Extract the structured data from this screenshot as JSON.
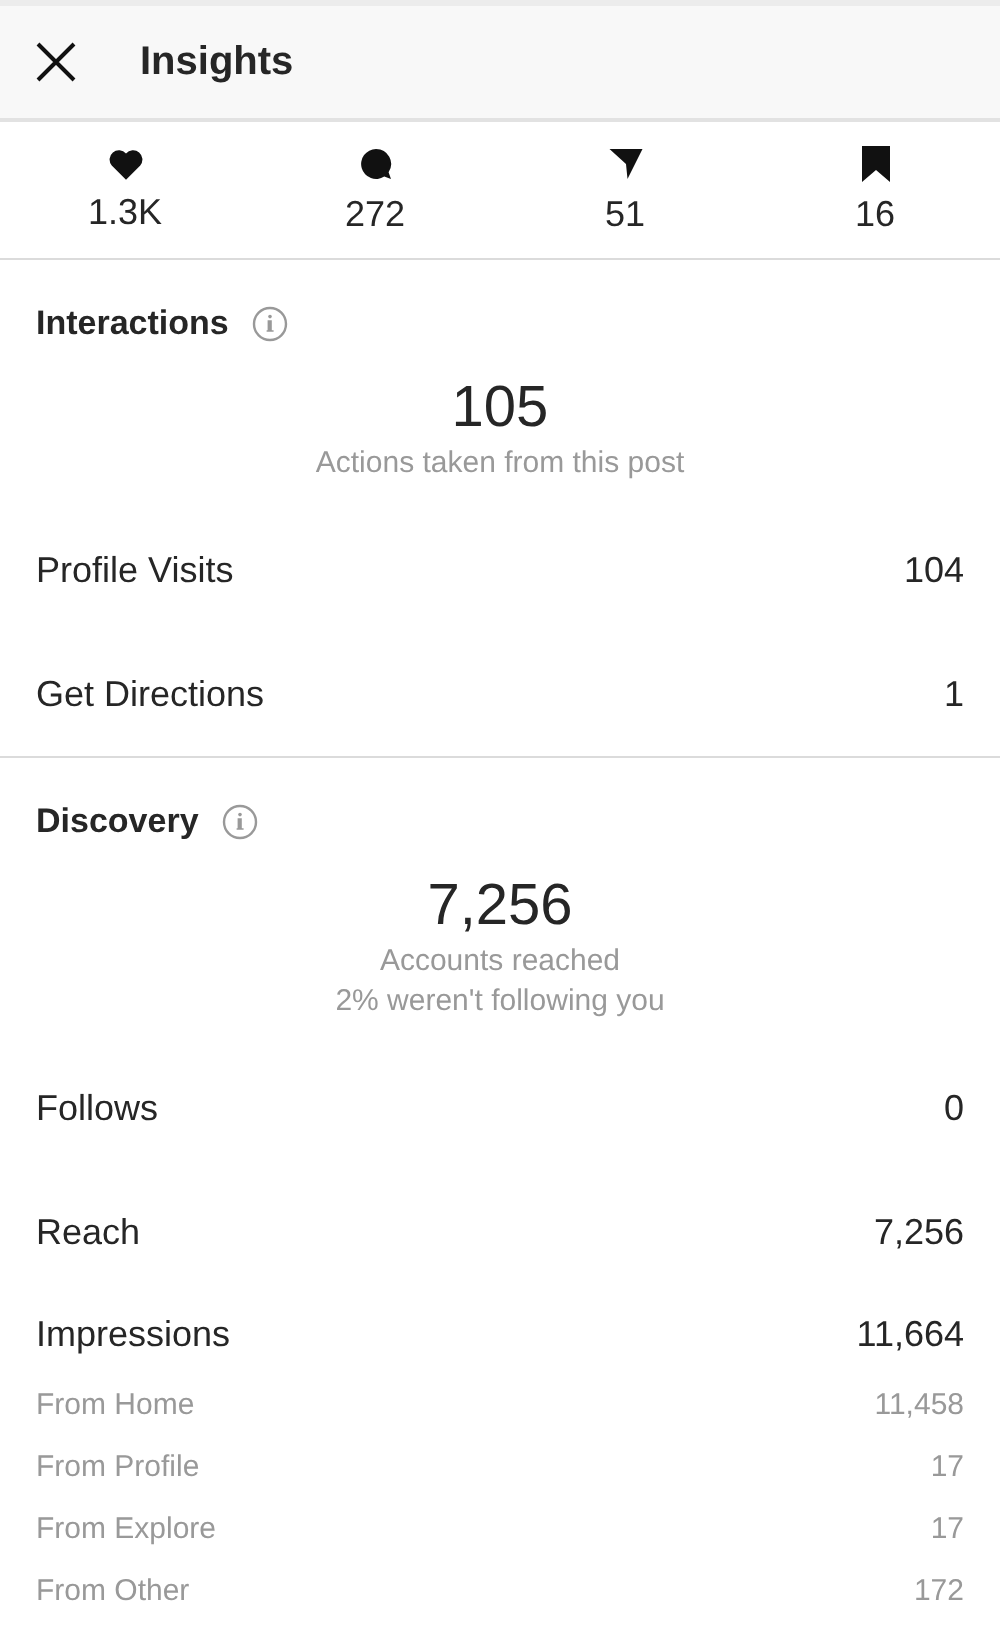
{
  "header": {
    "title": "Insights"
  },
  "stats": [
    {
      "kind": "like",
      "value": "1.3K"
    },
    {
      "kind": "comment",
      "value": "272"
    },
    {
      "kind": "share",
      "value": "51"
    },
    {
      "kind": "save",
      "value": "16"
    }
  ],
  "sections": [
    {
      "title": "Interactions",
      "total": "105",
      "captions": [
        "Actions taken from this post"
      ],
      "rows": [
        {
          "kind": "main",
          "label": "Profile Visits",
          "value": "104"
        },
        {
          "kind": "main",
          "label": "Get Directions",
          "value": "1"
        }
      ]
    },
    {
      "title": "Discovery",
      "total": "7,256",
      "captions": [
        "Accounts reached",
        "2% weren't following you"
      ],
      "rows": [
        {
          "kind": "main",
          "label": "Follows",
          "value": "0"
        },
        {
          "kind": "main",
          "label": "Reach",
          "value": "7,256"
        },
        {
          "kind": "group",
          "label": "Impressions",
          "value": "11,664"
        },
        {
          "kind": "sub",
          "label": "From Home",
          "value": "11,458"
        },
        {
          "kind": "sub",
          "label": "From Profile",
          "value": "17"
        },
        {
          "kind": "sub",
          "label": "From Explore",
          "value": "17"
        },
        {
          "kind": "sub",
          "label": "From Other",
          "value": "172"
        }
      ]
    }
  ]
}
